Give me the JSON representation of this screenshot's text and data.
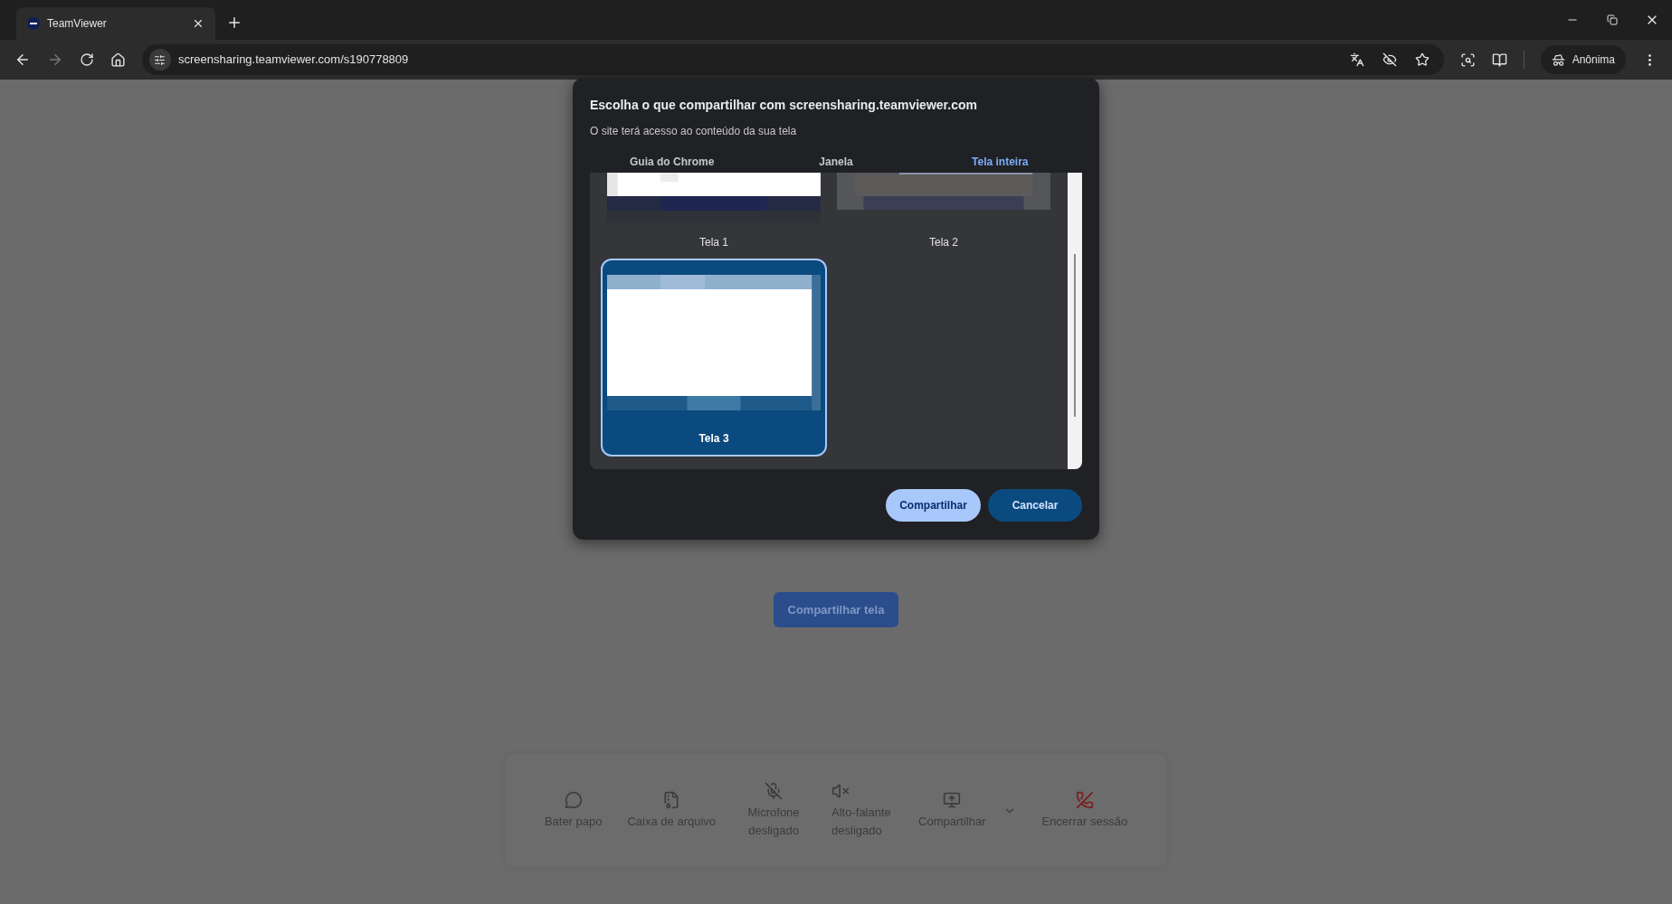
{
  "browser": {
    "tabs": [
      {
        "title": "TeamViewer",
        "selected": true
      }
    ],
    "url": "screensharing.teamviewer.com/s190778809",
    "forward_disabled": true,
    "profile": "Anônima"
  },
  "page": {
    "share_button": "Compartilhar tela",
    "toolbar": [
      {
        "label": "Bater papo",
        "kind": "chat"
      },
      {
        "label": "Caixa de arquivo",
        "kind": "file"
      },
      {
        "label": "Microfone desligado",
        "kind": "mic"
      },
      {
        "label": "Alto-falante desligado",
        "kind": "speaker"
      },
      {
        "label": "Compartilhar",
        "kind": "share",
        "menu": true
      },
      {
        "label": "Encerrar sessão",
        "kind": "end"
      }
    ]
  },
  "dialog": {
    "title": "Escolha o que compartilhar com screensharing.teamviewer.com",
    "subtitle": "O site terá acesso ao conteúdo da sua tela",
    "tabs": [
      {
        "label": "Guia do Chrome",
        "selected": false
      },
      {
        "label": "Janela",
        "selected": false
      },
      {
        "label": "Tela inteira",
        "selected": true
      }
    ],
    "sources": [
      {
        "label": "Tela 1",
        "selected": false
      },
      {
        "label": "Tela 2",
        "selected": false
      },
      {
        "label": "Tela 3",
        "selected": true
      }
    ],
    "buttons": [
      {
        "label": "Compartilhar",
        "kind": "tonal"
      },
      {
        "label": "Cancelar",
        "kind": "filled"
      }
    ]
  }
}
